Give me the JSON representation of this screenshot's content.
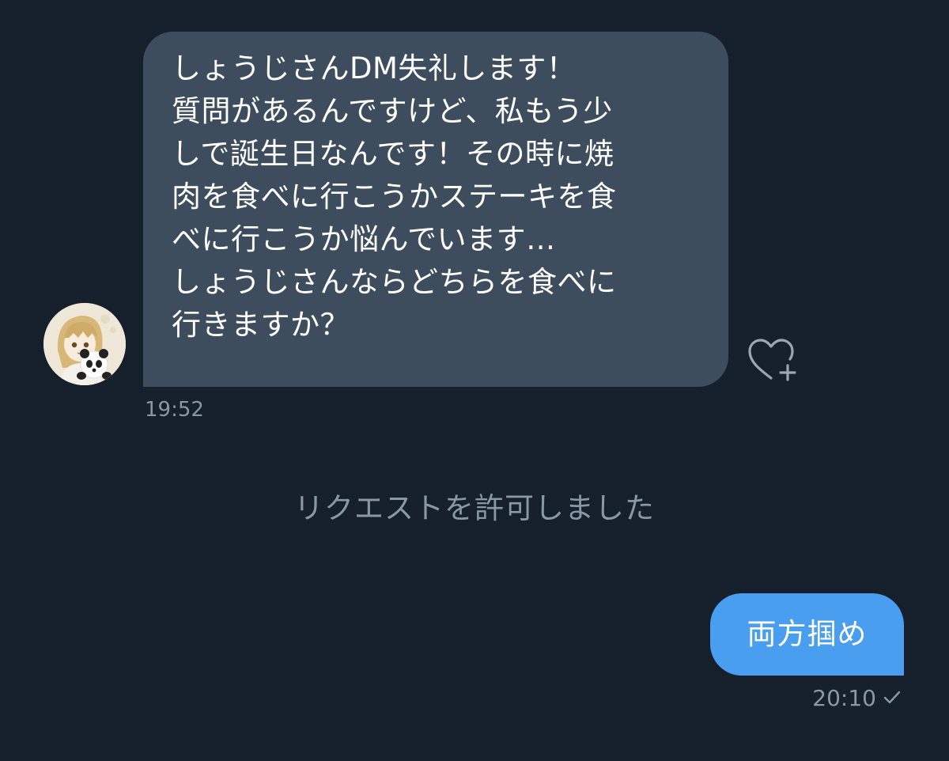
{
  "conversation": {
    "incoming": {
      "text": "しょうじさんDM失礼します！\n質問があるんですけど、私もう少\nしで誕生日なんです！その時に焼\n肉を食べに行こうかステーキを食\nべに行こうか悩んでいます…\nしょうじさんならどちらを食べに\n行きますか？",
      "time": "19:52",
      "avatar_icon": "anime-girl-with-panda-avatar",
      "react_icon": "heart-plus-icon"
    },
    "system_note": "リクエストを許可しました",
    "outgoing": {
      "text": "両方掴め",
      "time": "20:10",
      "status_icon": "check-icon"
    }
  },
  "colors": {
    "background": "#16202c",
    "incoming_bubble": "#3e4d5e",
    "outgoing_bubble": "#4a9ef0",
    "muted_text": "#8a97a5"
  }
}
